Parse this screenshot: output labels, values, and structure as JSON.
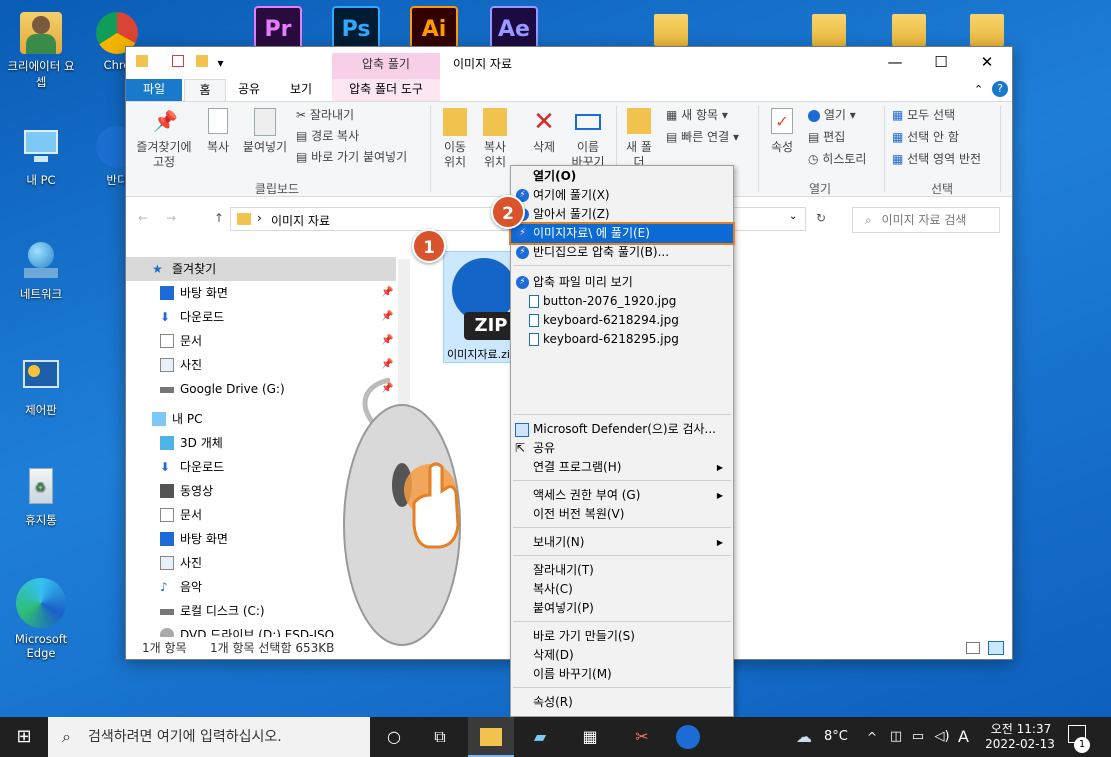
{
  "desktop": {
    "icons_left": [
      {
        "label": "크리에이터 요셉"
      },
      {
        "label": "내 PC"
      },
      {
        "label": "네트워크"
      },
      {
        "label": "제어판"
      },
      {
        "label": "휴지통"
      },
      {
        "label": "Microsoft Edge"
      }
    ],
    "icons_col2": [
      {
        "label": "Chro"
      },
      {
        "label": "반디"
      }
    ],
    "top_apps": [
      "Pr",
      "Ps",
      "Ai",
      "Ae"
    ]
  },
  "explorer": {
    "title": "이미지 자료",
    "contextual_tab_header": "압축 풀기",
    "tabs": [
      "파일",
      "홈",
      "공유",
      "보기",
      "압축 폴더 도구"
    ],
    "ribbon": {
      "clipboard": {
        "pin_label": "즐겨찾기에 고정",
        "copy_label": "복사",
        "paste_label": "붙여넣기",
        "cut_label": "잘라내기",
        "copy_path_label": "경로 복사",
        "paste_shortcut_label": "바로 가기 붙여넣기",
        "group_label": "클립보드"
      },
      "organize": {
        "move_label": "이동 위치",
        "copy_to_label": "복사 위치",
        "delete_label": "삭제",
        "rename_label": "이름 바꾸기"
      },
      "new": {
        "new_folder_label": "새 폴더",
        "new_item_label": "새 항목",
        "easy_access_label": "빠른 연결"
      },
      "open": {
        "properties_label": "속성",
        "open_label": "열기",
        "edit_label": "편집",
        "history_label": "히스토리",
        "group_label": "열기"
      },
      "select": {
        "select_all_label": "모두 선택",
        "select_none_label": "선택 안 함",
        "invert_label": "선택 영역 반전",
        "group_label": "선택"
      }
    },
    "address": {
      "path": "이미지 자료",
      "search_placeholder": "이미지 자료 검색"
    },
    "nav": [
      {
        "label": "즐겨찾기"
      },
      {
        "label": "바탕 화면"
      },
      {
        "label": "다운로드"
      },
      {
        "label": "문서"
      },
      {
        "label": "사진"
      },
      {
        "label": "Google Drive (G:)"
      },
      {
        "label": "내 PC"
      },
      {
        "label": "3D 개체"
      },
      {
        "label": "다운로드"
      },
      {
        "label": "동영상"
      },
      {
        "label": "문서"
      },
      {
        "label": "바탕 화면"
      },
      {
        "label": "사진"
      },
      {
        "label": "음악"
      },
      {
        "label": "로컬 디스크 (C:)"
      },
      {
        "label": "DVD 드라이브 (D:) ESD-ISO"
      }
    ],
    "file": {
      "name": "이미지자료.zip",
      "badge": "ZIP"
    },
    "status": {
      "count": "1개 항목",
      "selected": "1개 항목 선택함 653KB"
    }
  },
  "badges": {
    "one": "1",
    "two": "2"
  },
  "context_menu": {
    "items": [
      {
        "label": "열기(O)"
      },
      {
        "label": "여기에 풀기(X)"
      },
      {
        "label": "알아서 풀기(Z)"
      },
      {
        "label": "이미지자료\\ 에 풀기(E)"
      },
      {
        "label": "반디집으로 압축 풀기(B)..."
      },
      {
        "label": "압축 파일 미리 보기"
      },
      {
        "label": "button-2076_1920.jpg"
      },
      {
        "label": "keyboard-6218294.jpg"
      },
      {
        "label": "keyboard-6218295.jpg"
      },
      {
        "label": "Microsoft Defender(으)로 검사..."
      },
      {
        "label": "공유"
      },
      {
        "label": "연결 프로그램(H)"
      },
      {
        "label": "액세스 권한 부여 (G)"
      },
      {
        "label": "이전 버전 복원(V)"
      },
      {
        "label": "보내기(N)"
      },
      {
        "label": "잘라내기(T)"
      },
      {
        "label": "복사(C)"
      },
      {
        "label": "붙여넣기(P)"
      },
      {
        "label": "바로 가기 만들기(S)"
      },
      {
        "label": "삭제(D)"
      },
      {
        "label": "이름 바꾸기(M)"
      },
      {
        "label": "속성(R)"
      }
    ]
  },
  "taskbar": {
    "search_placeholder": "검색하려면 여기에 입력하십시오.",
    "weather": "8°C",
    "ime": "A",
    "time": "오전 11:37",
    "date": "2022-02-13",
    "notification_count": "1"
  }
}
